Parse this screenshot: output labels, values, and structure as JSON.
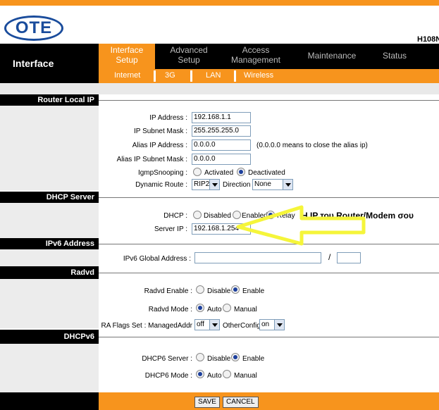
{
  "header": {
    "logo": "OTE",
    "model": "H108N"
  },
  "nav": {
    "section_title": "Interface",
    "tabs": [
      {
        "line1": "Interface",
        "line2": "Setup"
      },
      {
        "line1": "Advanced",
        "line2": "Setup"
      },
      {
        "line1": "Access",
        "line2": "Management"
      },
      {
        "line1": "Maintenance",
        "line2": ""
      },
      {
        "line1": "Status",
        "line2": ""
      }
    ],
    "subtabs": [
      "Internet",
      "3G",
      "LAN",
      "Wireless"
    ]
  },
  "router_local_ip": {
    "title": "Router Local IP",
    "ip_label": "IP Address :",
    "ip_value": "192.168.1.1",
    "mask_label": "IP Subnet Mask :",
    "mask_value": "255.255.255.0",
    "alias_label": "Alias IP Address :",
    "alias_value": "0.0.0.0",
    "alias_note": "(0.0.0.0 means to close the alias ip)",
    "alias_mask_label": "Alias IP Subnet Mask :",
    "alias_mask_value": "0.0.0.0",
    "igmp_label": "IgmpSnooping :",
    "igmp_opt1": "Activated",
    "igmp_opt2": "Deactivated",
    "route_label": "Dynamic Route :",
    "route_value": "RIP2",
    "direction_label": "Direction",
    "direction_value": "None"
  },
  "dhcp_server": {
    "title": "DHCP Server",
    "dhcp_label": "DHCP :",
    "opt1": "Disabled",
    "opt2": "Enabled",
    "opt3": "Relay",
    "server_ip_label": "Server IP :",
    "server_ip_value": "192.168.1.254",
    "annotation": "H IP του Router/Modem σου"
  },
  "ipv6": {
    "title": "IPv6 Address",
    "global_label": "IPv6 Global Address :",
    "global_value": "",
    "slash": "/",
    "prefix_value": ""
  },
  "radvd": {
    "title": "Radvd",
    "enable_label": "Radvd Enable :",
    "disable_opt": "Disable",
    "enable_opt": "Enable",
    "mode_label": "Radvd Mode :",
    "auto_opt": "Auto",
    "manual_opt": "Manual",
    "flags_label": "RA Flags Set : ManagedAddr",
    "managed_value": "off",
    "other_label": "OtherConfig",
    "other_value": "on"
  },
  "dhcpv6": {
    "title": "DHCPv6",
    "server_label": "DHCP6 Server :",
    "disable_opt": "Disable",
    "enable_opt": "Enable",
    "mode_label": "DHCP6 Mode :",
    "auto_opt": "Auto",
    "manual_opt": "Manual"
  },
  "footer": {
    "save": "SAVE",
    "cancel": "CANCEL"
  },
  "colors": {
    "accent": "#f7941d",
    "brand": "#1a4c9c",
    "highlight_arrow": "#f5f53a"
  }
}
